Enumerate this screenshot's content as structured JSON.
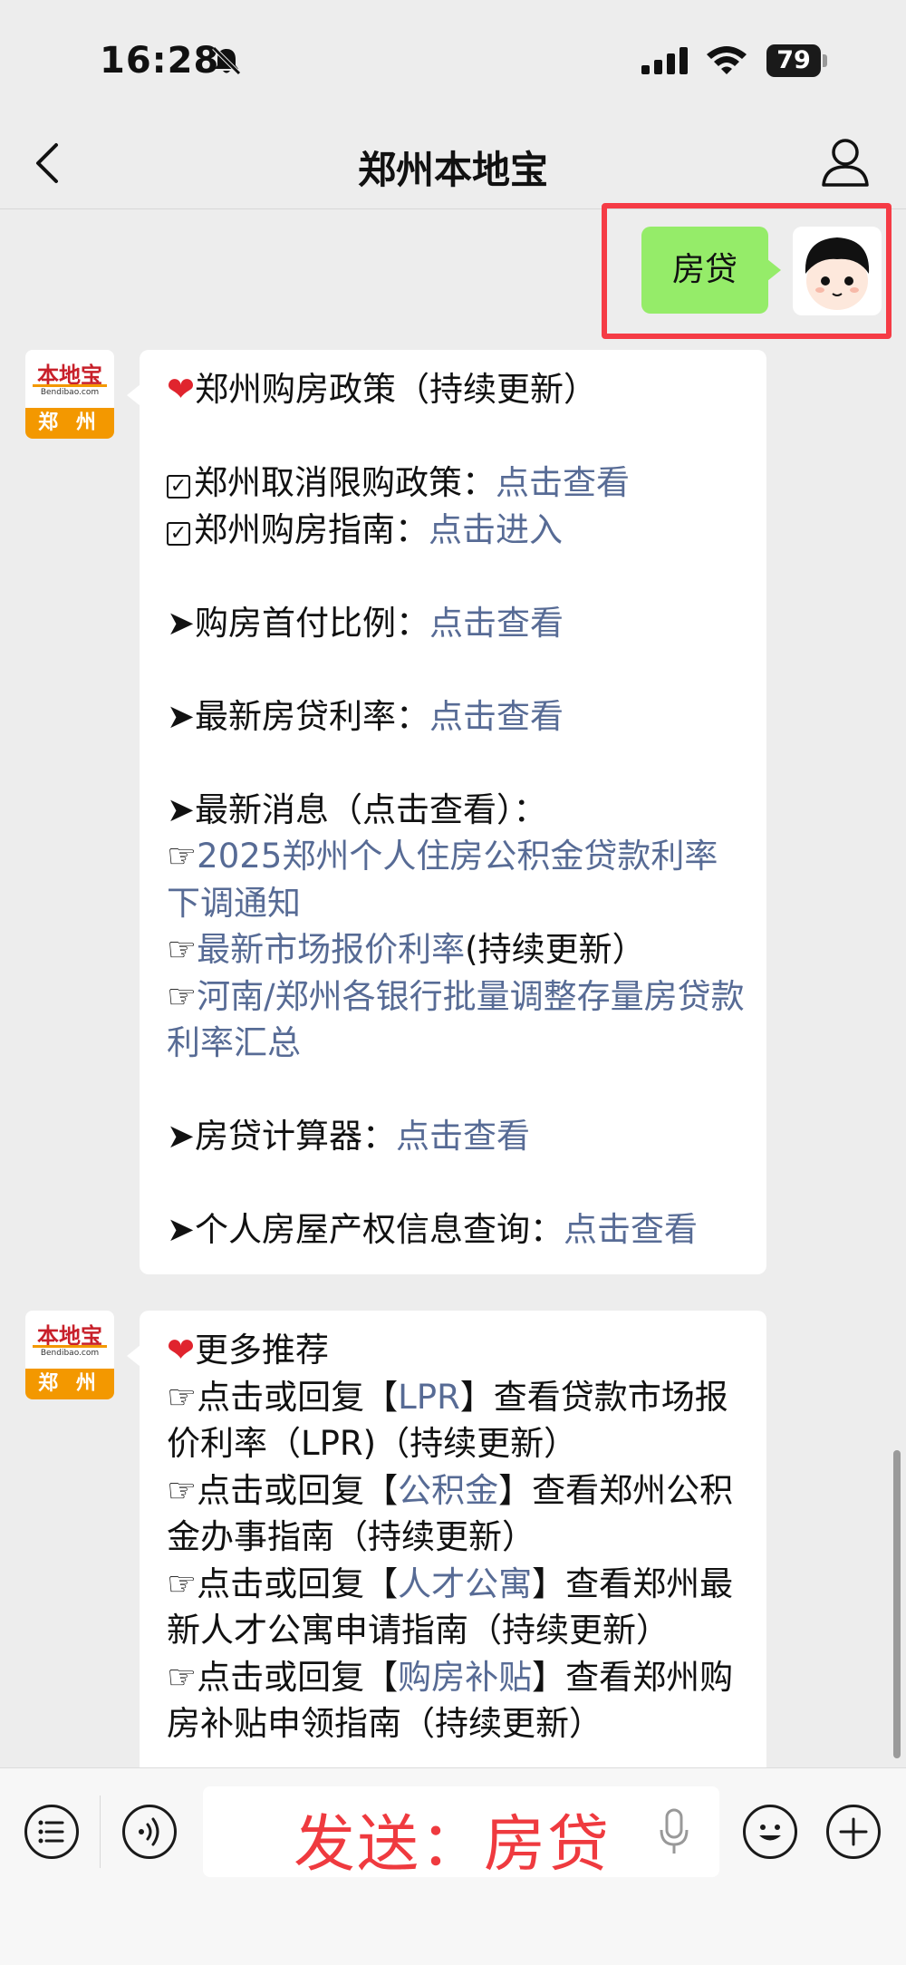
{
  "status_bar": {
    "time": "16:28",
    "battery": "79"
  },
  "nav": {
    "title": "郑州本地宝"
  },
  "outgoing": {
    "message": "房贷"
  },
  "bot_avatar": {
    "logo_text": "本地宝",
    "logo_url": "Bendibao.com",
    "city": "郑 州"
  },
  "message1": {
    "title": "郑州购房政策（持续更新）",
    "item1_label": "郑州取消限购政策：",
    "item1_link": "点击查看",
    "item2_label": "郑州购房指南：",
    "item2_link": "点击进入",
    "down_payment_label": "➤购房首付比例：",
    "down_payment_link": "点击查看",
    "rate_label": "➤最新房贷利率：",
    "rate_link": "点击查看",
    "news_label": "➤最新消息（点击查看）：",
    "news1_link": "2025郑州个人住房公积金贷款利率下调通知",
    "news2_link": "最新市场报价利率",
    "news2_suffix": "(持续更新）",
    "news3_link": "河南/郑州各银行批量调整存量房贷款利率汇总",
    "calc_label": "➤房贷计算器：",
    "calc_link": "点击查看",
    "property_label": "➤个人房屋产权信息查询：",
    "property_link": "点击查看"
  },
  "message2": {
    "title": "更多推荐",
    "items": [
      {
        "prefix": "☞点击或回复【",
        "keyword": "LPR",
        "suffix": "】查看贷款市场报价利率（LPR)（持续更新）"
      },
      {
        "prefix": "☞点击或回复【",
        "keyword": "公积金",
        "suffix": "】查看郑州公积金办事指南（持续更新）"
      },
      {
        "prefix": "☞点击或回复【",
        "keyword": "人才公寓",
        "suffix": "】查看郑州最新人才公寓申请指南（持续更新）"
      },
      {
        "prefix": "☞点击或回复【",
        "keyword": "购房补贴",
        "suffix": "】查看郑州购房补贴申领指南（持续更新）"
      }
    ]
  },
  "input": {
    "text": "发送：房贷"
  },
  "colors": {
    "link": "#576b95",
    "outgoing_bubble": "#95ec69",
    "highlight": "#f53b45",
    "input_text": "#ef3a3f"
  }
}
